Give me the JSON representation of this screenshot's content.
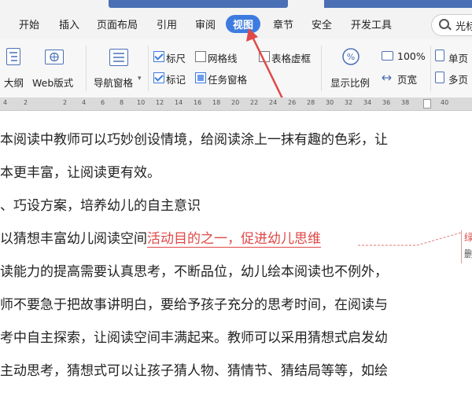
{
  "menu": {
    "items": [
      "开始",
      "插入",
      "页面布局",
      "引用",
      "审阅",
      "视图",
      "章节",
      "安全",
      "开发工具"
    ],
    "active": "视图",
    "search_label": "光标"
  },
  "ribbon": {
    "outline_label": "大纲",
    "web_label": "Web版式",
    "nav_label": "导航窗格",
    "nav_arrow": "▾",
    "ruler_label": "标尺",
    "gridlines_label": "网格线",
    "table_grid_label": "表格虚框",
    "marks_label": "标记",
    "task_pane_label": "任务窗格",
    "zoom_label": "显示比例",
    "zoom_100_label": "100%",
    "page_width_label": "页宽",
    "single_page_label": "单页",
    "multi_page_label": "多页"
  },
  "ruler": {
    "ticks": [
      "4",
      "2",
      "2",
      "4",
      "6",
      "8",
      "10",
      "12",
      "14",
      "16",
      "18",
      "20",
      "22",
      "24",
      "26",
      "28",
      "30",
      "32",
      "34",
      "36",
      "38",
      "40"
    ]
  },
  "document": {
    "lines": [
      "本阅读中教师可以巧妙创设情境，给阅读涂上一抹有趣的色彩，让",
      "本更丰富，让阅读更有效。",
      "、巧设方案，培养幼儿的自主意识",
      "以猜想丰富幼儿阅读空间",
      "读能力的提高需要认真思考，不断品位，幼儿绘本阅读也不例外，",
      "师不要急于把故事讲明白，要给予孩子充分的思考时间，在阅读与",
      "考中自主探索，让阅读空间丰满起来。教师可以采用猜想式启发幼",
      "主动思考，猜想式可以让孩子猜人物、猜情节、猜结局等等，如绘"
    ],
    "highlight": "活动目的之一，促进幼儿思维"
  },
  "side_comment": {
    "char1": "绿",
    "char2": "删"
  },
  "colors": {
    "accent": "#3d7be0",
    "annotation": "#e04848"
  }
}
